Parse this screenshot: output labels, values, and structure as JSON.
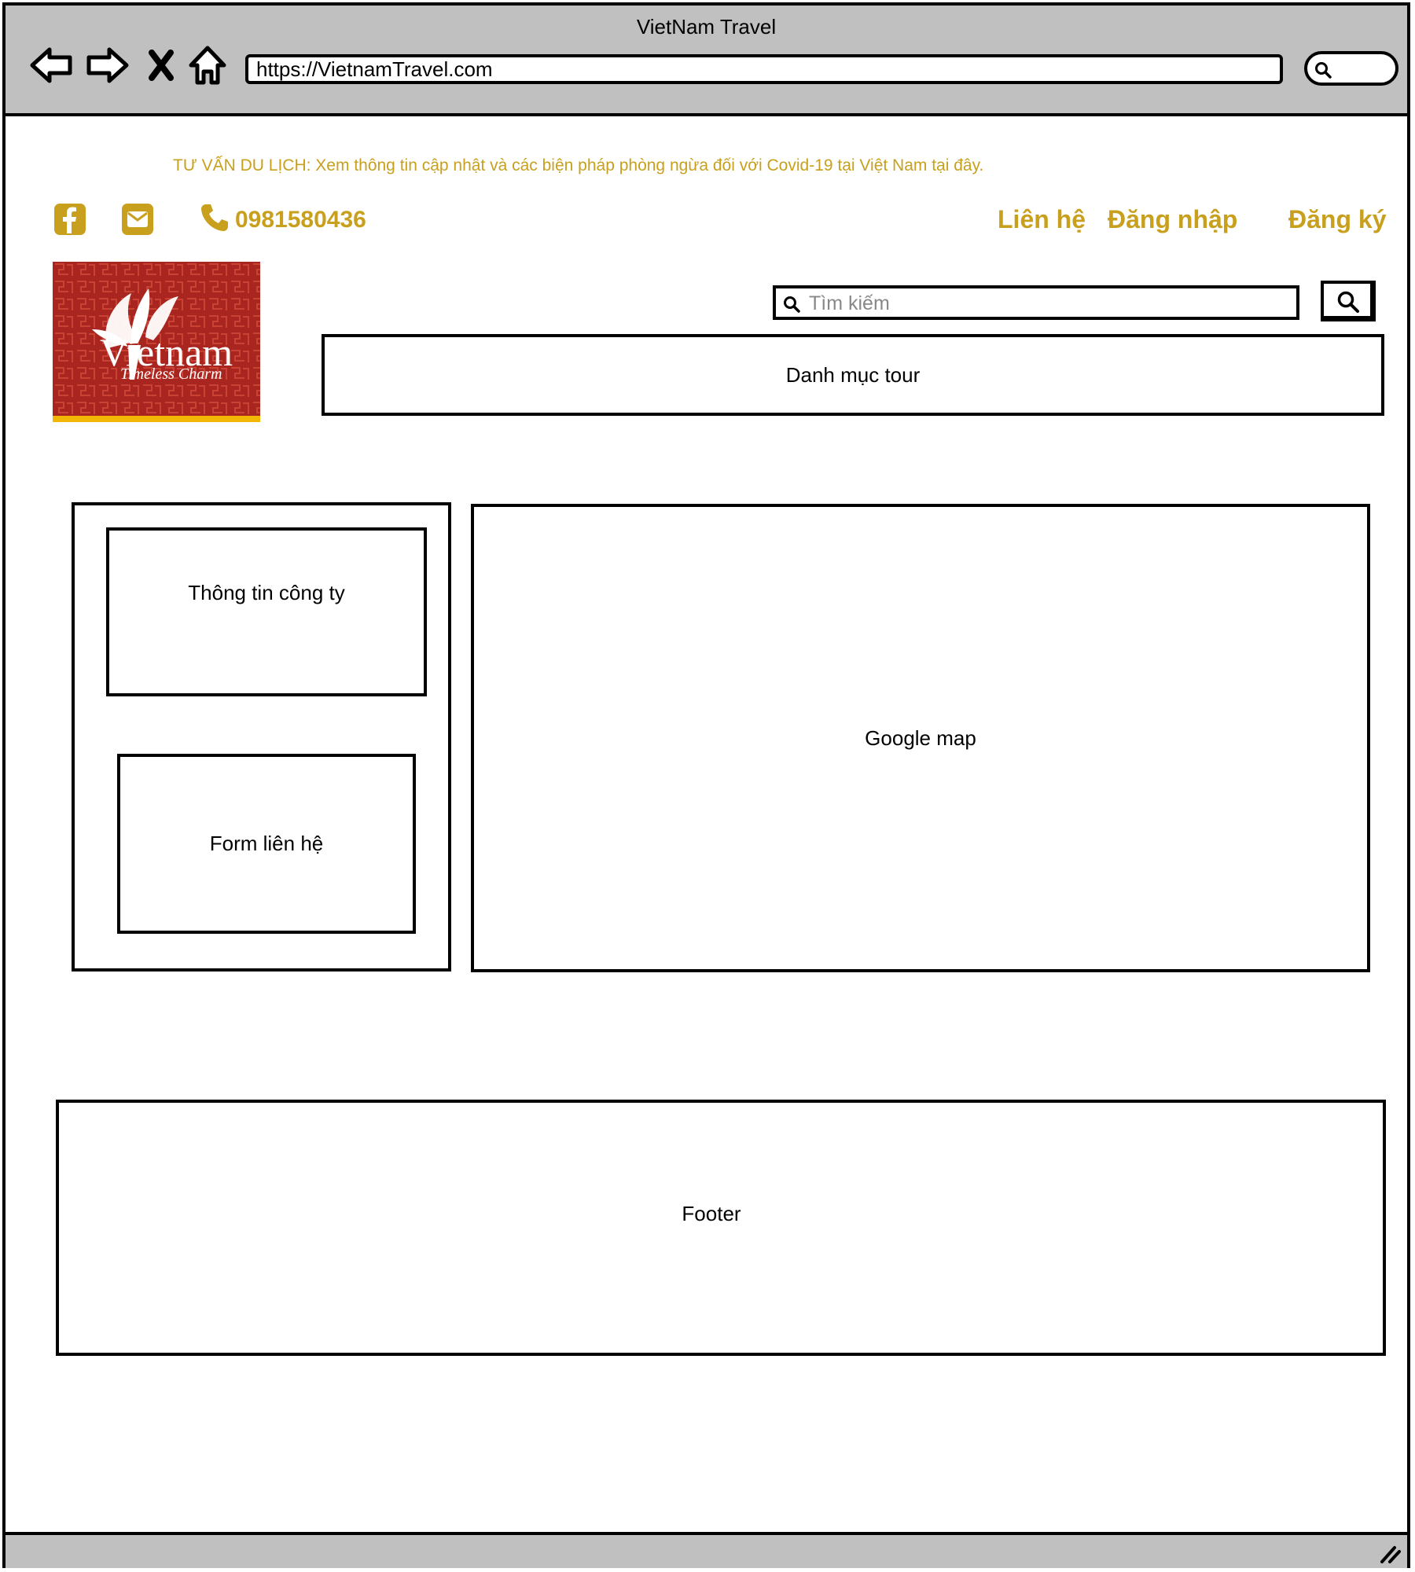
{
  "browser": {
    "title": "VietNam Travel",
    "url": "https://VietnamTravel.com",
    "nav_icons": [
      "back-arrow-icon",
      "forward-arrow-icon",
      "close-x-icon",
      "home-icon"
    ]
  },
  "header": {
    "advisory": "TƯ VẤN DU LỊCH: Xem thông tin cập nhật và các biện pháp phòng ngừa đối với Covid-19 tại Việt Nam tại đây.",
    "phone": "0981580436",
    "links": {
      "contact": "Liên hệ",
      "login": "Đăng nhập",
      "register": "Đăng ký"
    },
    "accent_color": "#c8a01e"
  },
  "logo": {
    "brand": "Vietnam",
    "tagline": "Timeless Charm",
    "background_color": "#a8261f"
  },
  "search": {
    "placeholder": "Tìm kiếm"
  },
  "nav": {
    "tour_catalog": "Danh mục tour"
  },
  "main": {
    "company_info": "Thông tin công ty",
    "contact_form": "Form liên hệ",
    "map": "Google map"
  },
  "footer": {
    "label": "Footer"
  }
}
